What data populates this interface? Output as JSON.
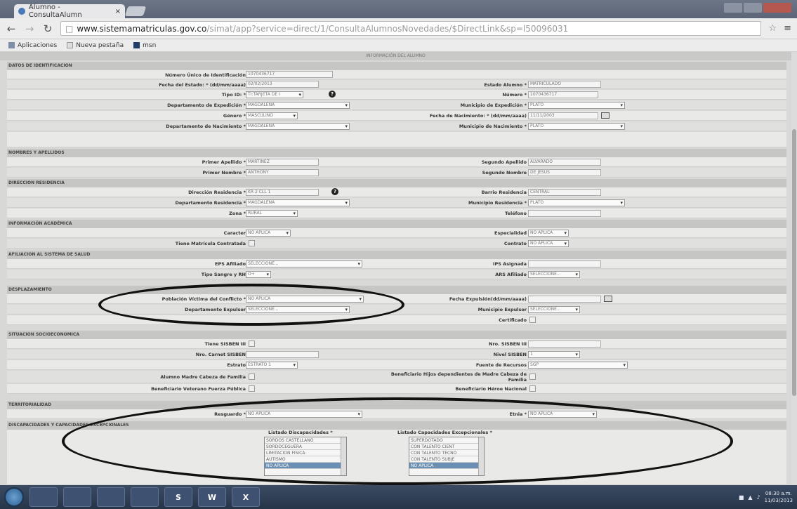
{
  "browser": {
    "tab_title": "Alumno - ConsultaAlumn",
    "tab_close": "×",
    "url_host": "www.sistemamatriculas.gov.co",
    "url_path": "/simat/app?service=direct/1/ConsultaAlumnosNovedades/$DirectLink&sp=l50096031",
    "bookmarks": [
      "Aplicaciones",
      "Nueva pestaña",
      "msn"
    ]
  },
  "page": {
    "banner": "INFORMACIÓN DEL ALUMNO",
    "sections": {
      "identificacion": "DATOS DE IDENTIFICACION",
      "nombres": "NOMBRES Y APELLIDOS",
      "residencia": "DIRECCION RESIDENCIA",
      "academica": "INFORMACIÓN ACADÉMICA",
      "salud": "AFILIACION AL SISTEMA DE SALUD",
      "desplazamiento": "DESPLAZAMIENTO",
      "socio": "SITUACION SOCIOECONOMICA",
      "territorialidad": "TERRITORIALIDAD",
      "discapacidades": "DISCAPACIDADES Y CAPACIDADES EXCEPCIONALES"
    },
    "fields": {
      "num_id_label": "Número Único de Identificación",
      "num_id_value": "1070436717",
      "fecha_estado_label": "Fecha del Estado: * (dd/mm/aaaa)",
      "fecha_estado_value": "02/02/2013",
      "estado_alumno_label": "Estado Alumno *",
      "estado_alumno_value": "MATRICULADO",
      "tipo_id_label": "Tipo ID: *",
      "tipo_id_value": "TI:TARJETA DE I",
      "numero_label": "Número *",
      "numero_value": "1070436717",
      "depto_exp_label": "Departamento de Expedición *",
      "depto_exp_value": "MAGDALENA",
      "mun_exp_label": "Municipio de Expedición *",
      "mun_exp_value": "PLATO",
      "genero_label": "Género *",
      "genero_value": "MASCULINO",
      "fecha_nac_label": "Fecha de Nacimiento: * (dd/mm/aaaa)",
      "fecha_nac_value": "11/11/2003",
      "depto_nac_label": "Departamento de Nacimiento *",
      "depto_nac_value": "MAGDALENA",
      "mun_nac_label": "Municipio de Nacimiento *",
      "mun_nac_value": "PLATO",
      "primer_apellido_label": "Primer Apellido *",
      "primer_apellido_value": "MARTINEZ",
      "segundo_apellido_label": "Segundo Apellido",
      "segundo_apellido_value": "ALVARADO",
      "primer_nombre_label": "Primer Nombre *",
      "primer_nombre_value": "ANTHONY",
      "segundo_nombre_label": "Segundo Nombre",
      "segundo_nombre_value": "DE JESUS",
      "direccion_label": "Dirección Residencia *",
      "direccion_value": "KR 2 CLL 1",
      "barrio_label": "Barrio Residencia",
      "barrio_value": "CENTRAL",
      "depto_res_label": "Departamento Residencia *",
      "depto_res_value": "MAGDALENA",
      "mun_res_label": "Municipio Residencia *",
      "mun_res_value": "PLATO",
      "zona_label": "Zona *",
      "zona_value": "RURAL",
      "telefono_label": "Teléfono",
      "telefono_value": "",
      "caracter_label": "Caracter",
      "caracter_value": "NO APLICA",
      "especialidad_label": "Especialidad",
      "especialidad_value": "NO APLICA",
      "matricula_contratada_label": "Tiene Matrícula Contratada",
      "contrato_label": "Contrato",
      "contrato_value": "NO APLICA",
      "eps_label": "EPS Afiliado",
      "eps_value": "SELECCIONE...",
      "ips_label": "IPS Asignada",
      "ips_value": "",
      "sangre_label": "Tipo Sangre y RH",
      "sangre_value": "O+",
      "ars_label": "ARS Afiliado",
      "ars_value": "SELECCIONE...",
      "victima_label": "Población Víctima del Conflicto *",
      "victima_value": "NO APLICA",
      "fecha_expulsion_label": "Fecha Expulsión(dd/mm/aaaa)",
      "fecha_expulsion_value": "",
      "depto_expulsor_label": "Departamento Expulsor",
      "depto_expulsor_value": "SELECCIONE...",
      "mun_expulsor_label": "Municipio Expulsor",
      "mun_expulsor_value": "SELECCIONE...",
      "certificado_label": "Certificado",
      "tiene_sisben_label": "Tiene SISBEN III",
      "nro_sisben_label": "Nro. SISBEN III",
      "nro_sisben_value": "",
      "carnet_label": "Nro. Carnet SISBEN",
      "carnet_value": "",
      "nivel_sisben_label": "Nivel SISBEN",
      "nivel_sisben_value": "1",
      "estrato_label": "Estrato",
      "estrato_value": "ESTRATO 1",
      "fuente_label": "Fuente de Recursos",
      "fuente_value": "SGP",
      "madre_cabeza_label": "Alumno Madre Cabeza de Familia",
      "beneficiario_hijos_label": "Beneficiario Hijos dependientes de Madre Cabeza de Familia",
      "veterano_label": "Beneficiario Veterano Fuerza Pública",
      "heroe_label": "Beneficiario Héroe Nacional",
      "resguardo_label": "Resguardo *",
      "resguardo_value": "NO APLICA",
      "etnia_label": "Etnia *",
      "etnia_value": "NO APLICA",
      "discapacidades_label": "Listado Discapacidades *",
      "capacidades_label": "Listado Capacidades Excepcionales *"
    },
    "discapacidades_list": [
      "SORDOS CASTELLANO",
      "SORDOCEGUERA",
      "LIMITACION FISICA",
      "AUTISMO",
      "NO APLICA"
    ],
    "capacidades_list": [
      "SUPERDOTADO",
      "CON TALENTO CIENT",
      "CON TALENTO TECNO",
      "CON TALENTO SUBJE",
      "NO APLICA"
    ]
  },
  "taskbar": {
    "apps": [
      "",
      "",
      "",
      "",
      "S",
      "W",
      "X"
    ],
    "time": "08:30 a.m.",
    "date": "11/03/2013"
  }
}
